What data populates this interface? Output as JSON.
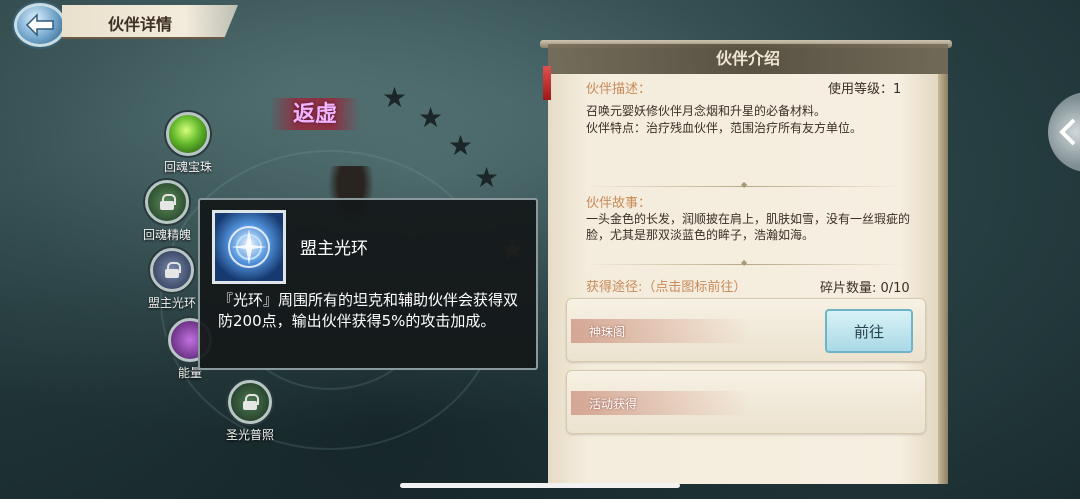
{
  "header": {
    "title": "伙伴详情"
  },
  "character": {
    "name": "返虚"
  },
  "skills": [
    {
      "label": "回魂宝珠",
      "locked": false
    },
    {
      "label": "回魂精魄",
      "locked": true
    },
    {
      "label": "盟主光环",
      "locked": true
    },
    {
      "label": "能量",
      "locked": false
    },
    {
      "label": "圣光普照",
      "locked": true
    }
  ],
  "tooltip": {
    "title": "盟主光环",
    "description": "『光环』周围所有的坦克和辅助伙伴会获得双防200点，输出伙伴获得5%的攻击加成。"
  },
  "panel": {
    "title": "伙伴介绍",
    "description_label": "伙伴描述：",
    "level_label": "使用等级：1",
    "description_line1": "召唤元婴妖修伙伴月念烟和升星的必备材料。",
    "description_line2": "伙伴特点：治疗残血伙伴，范围治疗所有友方单位。",
    "story_label": "伙伴故事：",
    "story_text": "一头金色的长发，润顺披在肩上，肌肤如雪，没有一丝瑕疵的脸，尤其是那双淡蓝色的眸子，浩瀚如海。",
    "source_label": "获得途径:（点击图标前往）",
    "fragment_label": "碎片数量: 0/10",
    "sources": [
      {
        "name": "神珠阁",
        "button": "前往"
      },
      {
        "name": "活动获得"
      }
    ]
  }
}
